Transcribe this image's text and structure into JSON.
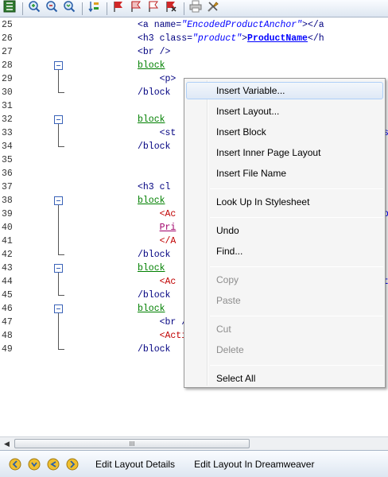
{
  "toolbar": {
    "buttons": [
      {
        "icon": "layout-tree-icon",
        "name": "tb-layout-tree-button"
      },
      {
        "icon": "search-add-icon",
        "name": "tb-find-add-button"
      },
      {
        "icon": "search-remove-icon",
        "name": "tb-find-remove-button"
      },
      {
        "icon": "search-refresh-icon",
        "name": "tb-find-refresh-button"
      },
      {
        "icon": "sort-icon",
        "name": "tb-sort-button"
      },
      {
        "icon": "flag-red-icon",
        "name": "tb-flag-1-button"
      },
      {
        "icon": "flag-outline-icon",
        "name": "tb-flag-2-button"
      },
      {
        "icon": "flag-outline-2-icon",
        "name": "tb-flag-3-button"
      },
      {
        "icon": "flag-clear-icon",
        "name": "tb-flag-clear-button"
      },
      {
        "icon": "print-icon",
        "name": "tb-print-button"
      },
      {
        "icon": "tools-icon",
        "name": "tb-tools-button"
      }
    ]
  },
  "editor": {
    "lines": [
      {
        "n": "25",
        "code": [
          [
            "t",
            "<a name="
          ],
          [
            "str",
            "\"EncodedProductAnchor\""
          ],
          [
            "t",
            "></a"
          ]
        ]
      },
      {
        "n": "26",
        "code": [
          [
            "t",
            "<h3 class="
          ],
          [
            "str",
            "\"product\""
          ],
          [
            "t",
            ">"
          ],
          [
            "lnk",
            "ProductName"
          ],
          [
            "t",
            "</h"
          ]
        ]
      },
      {
        "n": "27",
        "code": [
          [
            "t",
            "<br />"
          ]
        ]
      },
      {
        "n": "28",
        "code": [
          [
            "grn",
            "block"
          ]
        ]
      },
      {
        "n": "29",
        "code": [
          [
            "t",
            "    <p>"
          ]
        ]
      },
      {
        "n": "30",
        "code": [
          [
            "t",
            "/block"
          ]
        ]
      },
      {
        "n": "31",
        "code": []
      },
      {
        "n": "32",
        "code": [
          [
            "grn",
            "block"
          ]
        ]
      },
      {
        "n": "33",
        "code": [
          [
            "t",
            "    <st"
          ]
        ]
      },
      {
        "n": "34",
        "code": [
          [
            "t",
            "/block"
          ]
        ]
      },
      {
        "n": "35",
        "code": []
      },
      {
        "n": "36",
        "code": []
      },
      {
        "n": "37",
        "code": [
          [
            "t",
            "<h3 cl"
          ]
        ]
      },
      {
        "n": "38",
        "code": [
          [
            "grn",
            "block"
          ]
        ]
      },
      {
        "n": "39",
        "code": [
          [
            "red",
            "    <Ac"
          ]
        ]
      },
      {
        "n": "40",
        "code": [
          [
            "t",
            "    "
          ],
          [
            "mag",
            "Pri"
          ]
        ]
      },
      {
        "n": "41",
        "code": [
          [
            "red",
            "    </A"
          ]
        ]
      },
      {
        "n": "42",
        "code": [
          [
            "t",
            "/block"
          ]
        ]
      },
      {
        "n": "43",
        "code": [
          [
            "grn",
            "block"
          ]
        ]
      },
      {
        "n": "44",
        "code": [
          [
            "red",
            "    <Ac"
          ]
        ]
      },
      {
        "n": "45",
        "code": [
          [
            "t",
            "/block"
          ]
        ]
      },
      {
        "n": "46",
        "code": [
          [
            "grn",
            "block"
          ]
        ]
      },
      {
        "n": "47",
        "code": [
          [
            "t",
            "    <br />"
          ]
        ]
      },
      {
        "n": "48",
        "code": [
          [
            "red",
            "    <Actinic:PRICE_EXPLANATION PROD"
          ]
        ]
      },
      {
        "n": "49",
        "code": [
          [
            "t",
            "/block"
          ]
        ]
      }
    ],
    "right_clipped": [
      {
        "line": "33",
        "text": "s"
      },
      {
        "line": "39",
        "text": "p"
      },
      {
        "line": "44",
        "text": "t"
      }
    ]
  },
  "context_menu": {
    "items": [
      {
        "label": "Insert Variable...",
        "hover": true
      },
      {
        "label": "Insert Layout..."
      },
      {
        "label": "Insert Block"
      },
      {
        "label": "Insert Inner Page Layout"
      },
      {
        "label": "Insert File Name"
      },
      {
        "sep": true
      },
      {
        "label": "Look Up In Stylesheet"
      },
      {
        "sep": true
      },
      {
        "label": "Undo"
      },
      {
        "label": "Find..."
      },
      {
        "sep": true
      },
      {
        "label": "Copy",
        "disabled": true
      },
      {
        "label": "Paste",
        "disabled": true
      },
      {
        "sep": true
      },
      {
        "label": "Cut",
        "disabled": true
      },
      {
        "label": "Delete",
        "disabled": true
      },
      {
        "sep": true
      },
      {
        "label": "Select All"
      }
    ]
  },
  "scrollbar": {
    "thumb_grip": "III"
  },
  "bottom_bar": {
    "icons": [
      "nav-first-icon",
      "nav-prev-icon",
      "nav-back-icon",
      "nav-next-icon"
    ],
    "edit_details": "Edit Layout Details",
    "edit_dreamweaver": "Edit Layout In Dreamweaver"
  },
  "colors": {
    "keyword": "#000080",
    "string": "#0000ff",
    "block": "#008000",
    "actinic": "#c00000",
    "fold": "#3a63b8"
  }
}
